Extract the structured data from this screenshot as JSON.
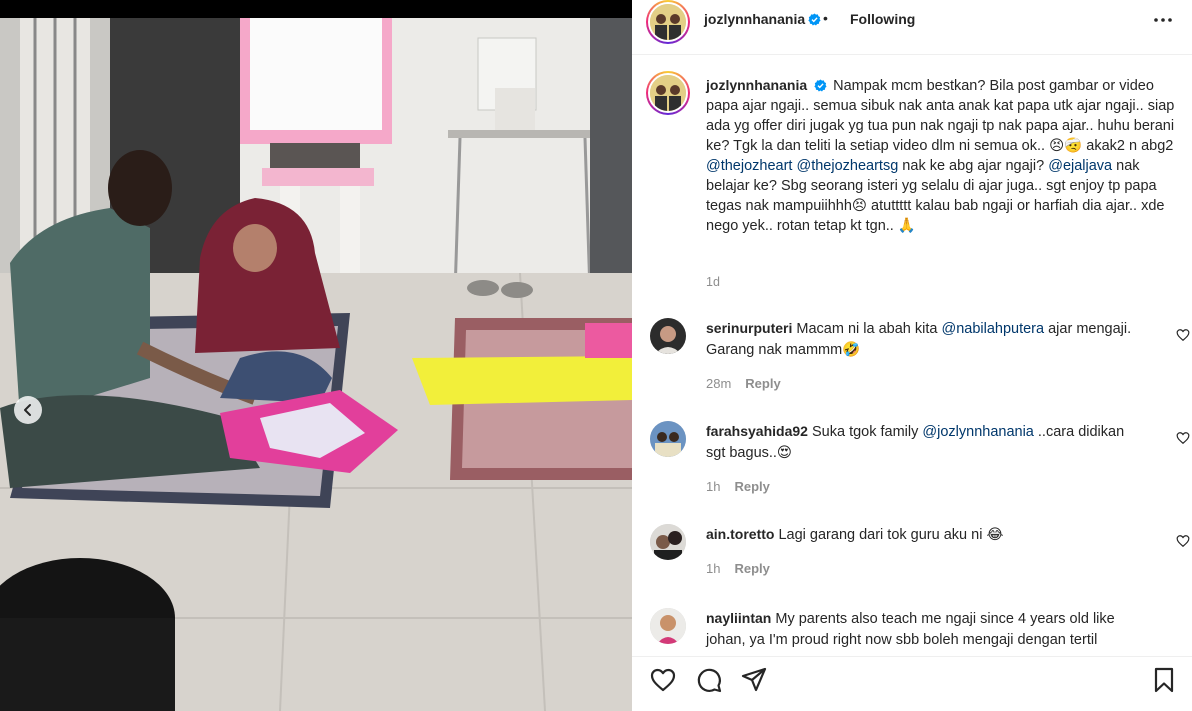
{
  "post": {
    "username": "jozlynnhanania",
    "follow_label": "Following",
    "dot": "•",
    "caption_text": "Nampak mcm bestkan? Bila post gambar or video papa ajar ngaji.. semua sibuk nak anta anak kat papa utk ajar ngaji.. siap ada yg offer diri jugak yg tua pun nak ngaji tp nak papa ajar.. huhu berani ke? Tgk la dan teliti la setiap video dlm ni semua ok.. 😣🤕 akak2 n abg2 ",
    "mention_1": "@thejozheart",
    "mention_2": "@thejozheartsg",
    "caption_mid": " nak ke abg ajar ngaji? ",
    "mention_3": "@ejaljava",
    "caption_end": " nak belajar ke? Sbg seorang isteri yg selalu di ajar juga.. sgt enjoy tp papa tegas nak mampuiihhh😣 atuttttt kalau bab ngaji or harfiah dia ajar.. xde nego yek.. rotan tetap kt tgn.. 🙏",
    "time_ago": "1d"
  },
  "comments": [
    {
      "username": "serinurputeri",
      "text_before": "Macam ni la abah kita ",
      "mention": "@nabilahputera",
      "text_after": " ajar mengaji. Garang nak mammm🤣",
      "time": "28m",
      "reply_label": "Reply"
    },
    {
      "username": "farahsyahida92",
      "text_before": "Suka tgok family ",
      "mention": "@jozlynnhanania",
      "text_after": " ..cara didikan sgt bagus..😍",
      "time": "1h",
      "reply_label": "Reply"
    },
    {
      "username": "ain.toretto",
      "text_before": "Lagi garang dari tok guru aku ni 😂",
      "mention": "",
      "text_after": "",
      "time": "1h",
      "reply_label": "Reply"
    },
    {
      "username": "nayliintan",
      "text_before": "My parents also teach me ngaji since 4 years old like johan, ya I'm proud right now sbb boleh mengaji dengan tertil",
      "mention": "",
      "text_after": "",
      "time": "",
      "reply_label": ""
    }
  ],
  "icons": {
    "verified": "verified-badge-icon",
    "more": "more-options-icon",
    "like": "heart-icon",
    "comment": "comment-icon",
    "share": "share-icon",
    "save": "bookmark-icon",
    "prev": "chevron-left-icon"
  },
  "colors": {
    "verified_blue": "#0095f6",
    "link_blue": "#00376b",
    "muted_gray": "#8e8e8e"
  }
}
